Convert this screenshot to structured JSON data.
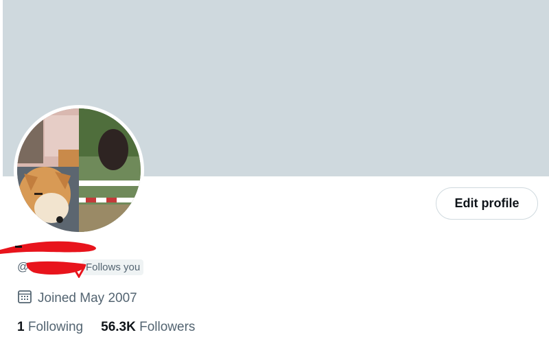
{
  "profile": {
    "handle_prefix": "@",
    "follows_you": "Follows you",
    "joined": "Joined May 2007",
    "edit_button": "Edit profile"
  },
  "stats": {
    "following_count": "1",
    "following_label": "Following",
    "followers_count": "56.3K",
    "followers_label": "Followers"
  },
  "icons": {
    "calendar": "calendar-icon"
  },
  "colors": {
    "banner": "#cfd9de",
    "secondary_text": "#536471",
    "primary_text": "#0f1419",
    "redaction": "#e8141c"
  }
}
